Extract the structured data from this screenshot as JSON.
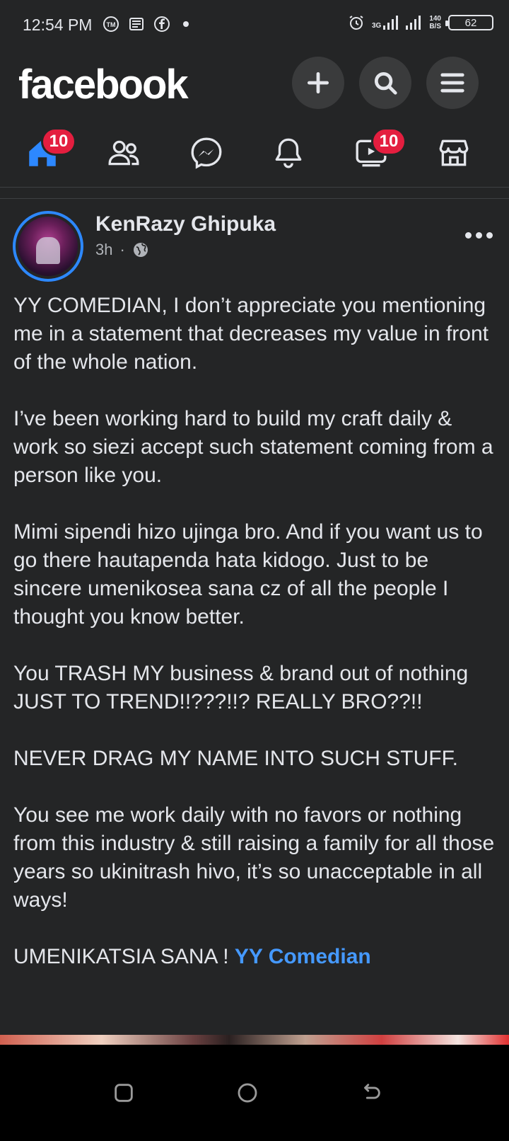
{
  "status_bar": {
    "time": "12:54 PM",
    "net_type": "3G",
    "net_speed_value": "140",
    "net_speed_unit": "B/S",
    "battery": "62"
  },
  "header": {
    "logo": "facebook",
    "icons": [
      "plus-icon",
      "search-icon",
      "menu-icon"
    ]
  },
  "nav": {
    "tabs": [
      {
        "name": "home",
        "badge": "10",
        "active": true
      },
      {
        "name": "friends",
        "badge": ""
      },
      {
        "name": "messenger",
        "badge": ""
      },
      {
        "name": "notifications",
        "badge": ""
      },
      {
        "name": "watch",
        "badge": "10"
      },
      {
        "name": "marketplace",
        "badge": ""
      }
    ]
  },
  "post": {
    "author": "KenRazy Ghipuka",
    "time": "3h",
    "separator": "·",
    "paragraphs": [
      "YY COMEDIAN, I don’t appreciate you mentioning me in a statement that decreases my value in front of the whole nation.",
      "I’ve been working hard to build my craft daily & work so siezi accept such statement coming from a person like you.",
      "Mimi sipendi hizo ujinga bro. And if you want us to go there hautapenda hata kidogo. Just to be sincere umenikosea sana cz of all the people I thought you know better.",
      "You TRASH MY business & brand out of nothing JUST TO TREND!!???!!? REALLY BRO??!!",
      "NEVER DRAG MY NAME INTO SUCH STUFF.",
      "You see me work daily with no favors or nothing from this industry & still raising a family for all those years so ukinitrash hivo, it’s so unacceptable in all ways!"
    ],
    "last_line_text": "UMENIKATSIA SANA ! ",
    "mention": "YY Comedian"
  },
  "colors": {
    "background": "#242526",
    "accent": "#2d88ff",
    "badge": "#e41e3f",
    "mention": "#4599ff"
  }
}
